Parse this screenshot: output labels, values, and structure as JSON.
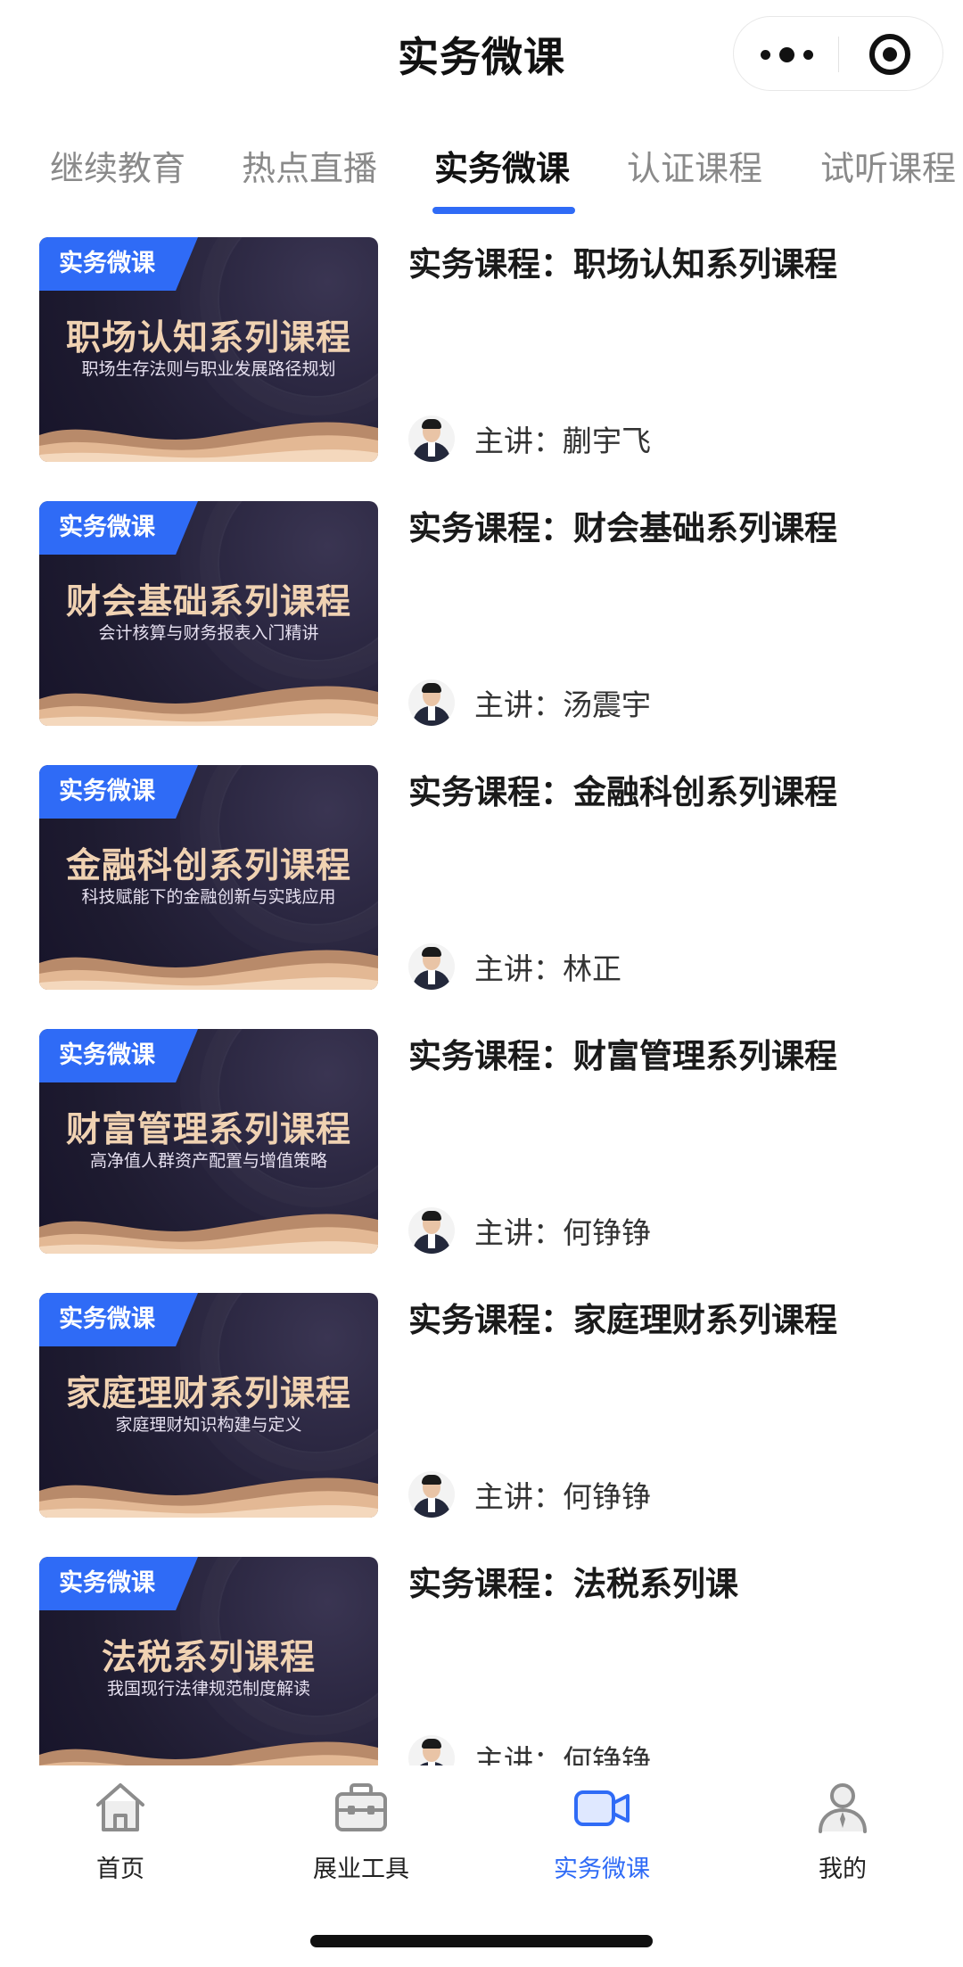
{
  "header": {
    "title": "实务微课"
  },
  "tabs": [
    {
      "label": "继续教育"
    },
    {
      "label": "热点直播"
    },
    {
      "label": "实务微课"
    },
    {
      "label": "认证课程"
    },
    {
      "label": "试听课程"
    }
  ],
  "active_tab": "实务微课",
  "lecturer_prefix": "主讲：",
  "courses": [
    {
      "badge": "实务微课",
      "thumb_title": "职场认知系列课程",
      "thumb_sub": "职场生存法则与职业发展路径规划",
      "title": "实务课程：职场认知系列课程",
      "lecturer": "蒯宇飞"
    },
    {
      "badge": "实务微课",
      "thumb_title": "财会基础系列课程",
      "thumb_sub": "会计核算与财务报表入门精讲",
      "title": "实务课程：财会基础系列课程",
      "lecturer": "汤震宇"
    },
    {
      "badge": "实务微课",
      "thumb_title": "金融科创系列课程",
      "thumb_sub": "科技赋能下的金融创新与实践应用",
      "title": "实务课程：金融科创系列课程",
      "lecturer": "林正"
    },
    {
      "badge": "实务微课",
      "thumb_title": "财富管理系列课程",
      "thumb_sub": "高净值人群资产配置与增值策略",
      "title": "实务课程：财富管理系列课程",
      "lecturer": "何铮铮"
    },
    {
      "badge": "实务微课",
      "thumb_title": "家庭理财系列课程",
      "thumb_sub": "家庭理财知识构建与定义",
      "title": "实务课程：家庭理财系列课程",
      "lecturer": "何铮铮"
    },
    {
      "badge": "实务微课",
      "thumb_title": "法税系列课程",
      "thumb_sub": "我国现行法律规范制度解读",
      "title": "实务课程：法税系列课",
      "lecturer": "何铮铮"
    }
  ],
  "tabbar": [
    {
      "label": "首页",
      "icon": "home-icon"
    },
    {
      "label": "展业工具",
      "icon": "toolbox-icon"
    },
    {
      "label": "实务微课",
      "icon": "video-camera-icon"
    },
    {
      "label": "我的",
      "icon": "user-icon"
    }
  ],
  "colors": {
    "accent": "#2f6bf6",
    "thumb_bg": "#1e1b30",
    "thumb_title": "#f0d2b2"
  }
}
